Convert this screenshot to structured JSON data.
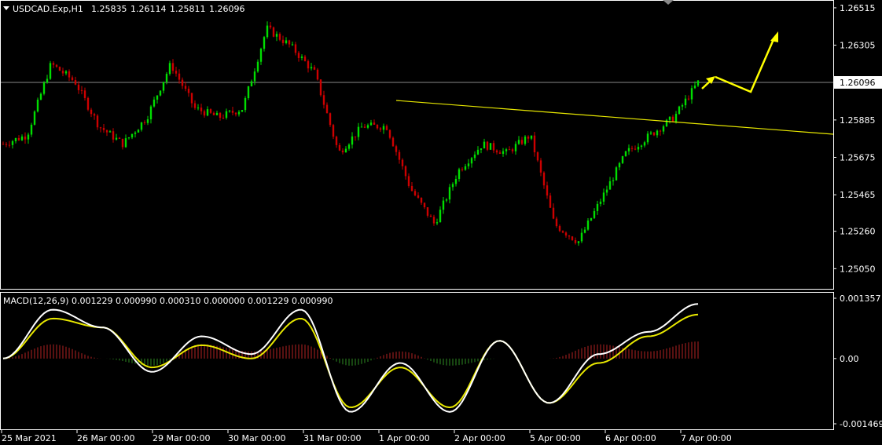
{
  "header": {
    "symbol": "USDCAD.Exp,H1",
    "open": "1.25835",
    "high": "1.26114",
    "low": "1.25811",
    "close": "1.26096"
  },
  "colors": {
    "background": "#000000",
    "bull": "#00dd00",
    "bear": "#cc0000",
    "frame": "#ffffff",
    "trendline": "#e8e800",
    "arrow": "#ffff00",
    "bid_line": "#888888",
    "macd_line": "#ffffff",
    "signal_line": "#e8e800",
    "hist_pos": "#b22222",
    "hist_neg": "#2e8b22"
  },
  "price_axis": {
    "ticks": [
      "1.26515",
      "1.26305",
      "1.26096",
      "1.25885",
      "1.25675",
      "1.25465",
      "1.25260",
      "1.25050"
    ],
    "current_price_label": "1.26096"
  },
  "macd_panel": {
    "title": "MACD(12,26,9) 0.001229 0.000990 0.000310 0.000000 0.001229 0.000990",
    "ticks": [
      "0.001357",
      "0.00",
      "-0.001469"
    ]
  },
  "time_axis": {
    "labels": [
      "25 Mar 2021",
      "26 Mar 00:00",
      "29 Mar 00:00",
      "30 Mar 00:00",
      "31 Mar 00:00",
      "1 Apr 00:00",
      "2 Apr 00:00",
      "5 Apr 00:00",
      "6 Apr 00:00",
      "7 Apr 00:00"
    ]
  },
  "chart_data": [
    {
      "type": "candlestick",
      "title": "USDCAD.Exp,H1",
      "timeframe": "H1",
      "ylim": [
        1.2495,
        1.2655
      ],
      "current_price": 1.26096,
      "close_path": [
        [
          "25 Mar 2021",
          1.2575
        ],
        [
          "25 Mar 12:00",
          1.258
        ],
        [
          "25 Mar 20:00",
          1.262
        ],
        [
          "26 Mar 00:00",
          1.261
        ],
        [
          "26 Mar 12:00",
          1.2585
        ],
        [
          "26 Mar 20:00",
          1.2575
        ],
        [
          "29 Mar 00:00",
          1.259
        ],
        [
          "29 Mar 10:00",
          1.262
        ],
        [
          "29 Mar 20:00",
          1.2595
        ],
        [
          "30 Mar 00:00",
          1.259
        ],
        [
          "30 Mar 12:00",
          1.2595
        ],
        [
          "30 Mar 20:00",
          1.264
        ],
        [
          "31 Mar 00:00",
          1.263
        ],
        [
          "31 Mar 12:00",
          1.2615
        ],
        [
          "31 Mar 20:00",
          1.257
        ],
        [
          "1 Apr 00:00",
          1.2585
        ],
        [
          "1 Apr 10:00",
          1.2585
        ],
        [
          "1 Apr 20:00",
          1.255
        ],
        [
          "2 Apr 00:00",
          1.253
        ],
        [
          "2 Apr 12:00",
          1.256
        ],
        [
          "2 Apr 20:00",
          1.2575
        ],
        [
          "5 Apr 00:00",
          1.257
        ],
        [
          "5 Apr 10:00",
          1.258
        ],
        [
          "5 Apr 20:00",
          1.253
        ],
        [
          "6 Apr 00:00",
          1.252
        ],
        [
          "6 Apr 12:00",
          1.2545
        ],
        [
          "6 Apr 20:00",
          1.257
        ],
        [
          "7 Apr 00:00",
          1.258
        ],
        [
          "7 Apr 08:00",
          1.259
        ],
        [
          "7 Apr 10:00",
          1.26096
        ]
      ]
    },
    {
      "type": "line",
      "title": "MACD(12,26,9) 0.001229 0.000990 0.000310 0.000000 0.001229 0.000990",
      "ylim": [
        -0.001469,
        0.001357
      ],
      "series": [
        {
          "name": "MACD",
          "values": [
            0.0,
            0.0011,
            0.0007,
            -0.0003,
            0.0005,
            0.0001,
            0.0011,
            -0.0012,
            -0.0001,
            -0.0012,
            0.0004,
            -0.001,
            0.0001,
            0.0006,
            0.001229
          ]
        },
        {
          "name": "Signal",
          "values": [
            0.0,
            0.0009,
            0.0007,
            -0.0002,
            0.0003,
            0.0,
            0.0009,
            -0.0011,
            -0.0002,
            -0.0011,
            0.0004,
            -0.001,
            -0.0001,
            0.0005,
            0.00099
          ]
        }
      ]
    }
  ]
}
